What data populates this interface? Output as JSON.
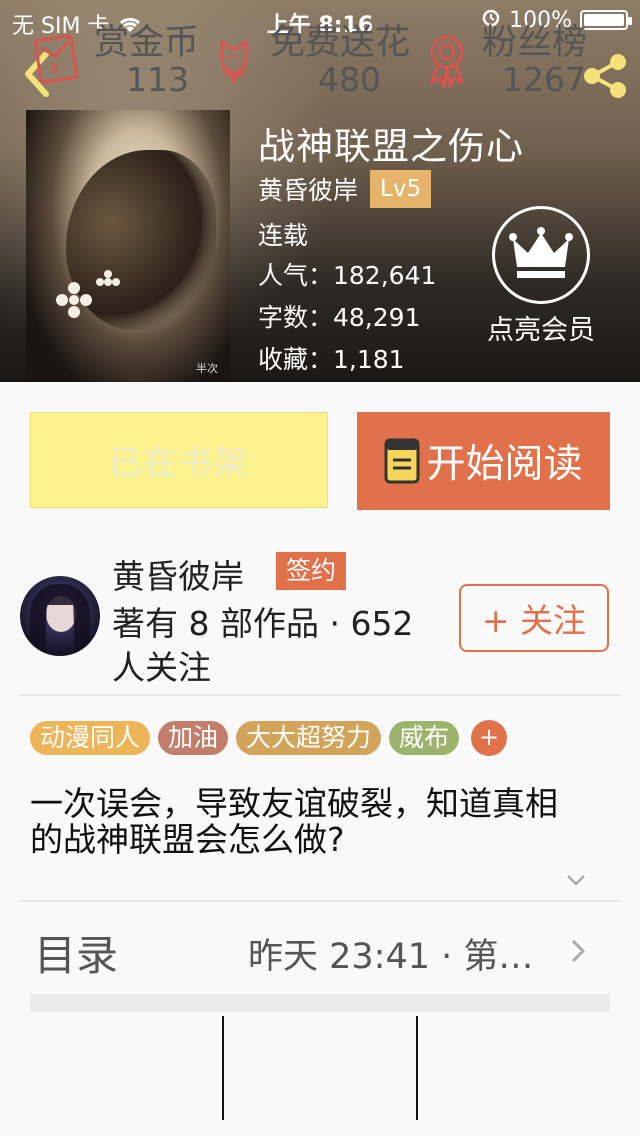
{
  "status_bar": {
    "carrier": "无 SIM 卡",
    "time": "上午 8:16",
    "battery": "100%"
  },
  "book": {
    "title": "战神联盟之伤心",
    "author": "黄昏彼岸",
    "level": "Lv5",
    "status": "连载",
    "popularity": "人气：182,641",
    "word_count": "字数：48,291",
    "favorites": "收藏：1,181",
    "cover_signature": "半次"
  },
  "vip": {
    "label": "点亮会员"
  },
  "actions": {
    "shelf_label": "已在书架",
    "read_label": "开始阅读"
  },
  "author_info": {
    "name": "黄昏彼岸",
    "badge": "签约",
    "works": "著有 8 部作品 · 652 人关注",
    "follow_label": "+ 关注"
  },
  "tags": [
    {
      "label": "动漫同人",
      "color": "#eeb45a"
    },
    {
      "label": "加油",
      "color": "#c27e6b"
    },
    {
      "label": "大大超努力",
      "color": "#d2a45a"
    },
    {
      "label": "威布",
      "color": "#9bb36b"
    }
  ],
  "tag_add": "+",
  "description": "一次误会，导致友谊破裂，知道真相的战神联盟会怎么做?",
  "toc": {
    "label": "目录",
    "latest": "昨天 23:41 · 第…"
  },
  "bottom": {
    "reward": {
      "label": "赏金币",
      "count": "113"
    },
    "flower": {
      "label": "免费送花",
      "count": "480"
    },
    "fans": {
      "label": "粉丝榜",
      "count": "1267"
    }
  },
  "colors": {
    "accent": "#e0714a",
    "shelf_bg": "#fdf38e",
    "gold": "#e6b36a"
  }
}
